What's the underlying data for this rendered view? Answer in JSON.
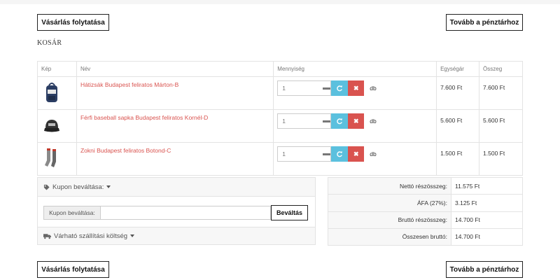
{
  "buttons": {
    "continue_shopping": "Vásárlás folytatása",
    "checkout": "Tovább a pénztárhoz"
  },
  "cart": {
    "title": "KOSÁR",
    "columns": {
      "image": "Kép",
      "name": "Név",
      "quantity": "Mennyiség",
      "unit_price": "Egységár",
      "total": "Összeg"
    },
    "items": [
      {
        "name": "Hátizsák Budapest feliratos Márton-B",
        "quantity": "1",
        "unit": "db",
        "unit_price": "7.600 Ft",
        "total": "7.600 Ft",
        "thumb": "backpack-icon"
      },
      {
        "name": "Férfi baseball sapka Budapest feliratos Kornél-D",
        "quantity": "1",
        "unit": "db",
        "unit_price": "5.600 Ft",
        "total": "5.600 Ft",
        "thumb": "cap-icon"
      },
      {
        "name": "Zokni Budapest feliratos Botond-C",
        "quantity": "1",
        "unit": "db",
        "unit_price": "1.500 Ft",
        "total": "1.500 Ft",
        "thumb": "socks-icon"
      }
    ]
  },
  "coupon": {
    "heading": "Kupon beváltása:",
    "addon_label": "Kupon beváltása:",
    "input_value": "",
    "button": "Beváltás"
  },
  "shipping": {
    "heading": "Várható szállítási költség"
  },
  "totals": [
    {
      "label": "Nettó részösszeg:",
      "value": "11.575 Ft"
    },
    {
      "label": "ÁFA (27%):",
      "value": "3.125 Ft"
    },
    {
      "label": "Bruttó részösszeg:",
      "value": "14.700 Ft"
    },
    {
      "label": "Összesen bruttó:",
      "value": "14.700 Ft"
    }
  ],
  "colors": {
    "link_red": "#d9534f",
    "refresh_blue": "#5bc0de",
    "remove_red": "#d9534f"
  }
}
